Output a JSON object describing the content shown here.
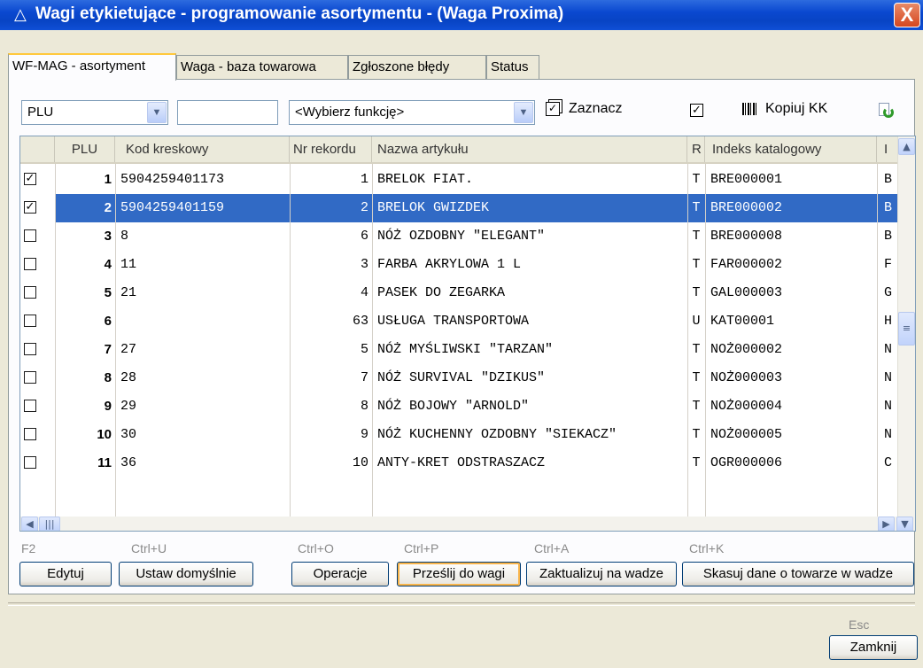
{
  "window": {
    "title": "Wagi etykietujące - programowanie asortymentu - (Waga Proxima)",
    "close": "X"
  },
  "tabs": [
    {
      "label": "WF-MAG - asortyment"
    },
    {
      "label": "Waga - baza towarowa"
    },
    {
      "label": "Zgłoszone błędy"
    },
    {
      "label": "Status"
    }
  ],
  "toolbar": {
    "field_select": "PLU",
    "search_value": "",
    "function_select": "<Wybierz funkcję>",
    "mark_label": "Zaznacz",
    "copy_label": "Kopiuj KK"
  },
  "grid": {
    "headers": [
      "PLU",
      "Kod kreskowy",
      "Nr rekordu",
      "Nazwa artykułu",
      "R",
      "Indeks katalogowy",
      "I"
    ],
    "rows": [
      {
        "checked": true,
        "plu": "1",
        "barcode": "5904259401173",
        "rec": "1",
        "name": "BRELOK FIAT.",
        "r": "T",
        "index": "BRE000001",
        "extra": "B"
      },
      {
        "checked": true,
        "plu": "2",
        "barcode": "5904259401159",
        "rec": "2",
        "name": "BRELOK GWIZDEK",
        "r": "T",
        "index": "BRE000002",
        "extra": "B",
        "selected": true
      },
      {
        "checked": false,
        "plu": "3",
        "barcode": "8",
        "rec": "6",
        "name": "NÓŻ OZDOBNY \"ELEGANT\"",
        "r": "T",
        "index": "BRE000008",
        "extra": "B"
      },
      {
        "checked": false,
        "plu": "4",
        "barcode": "11",
        "rec": "3",
        "name": "FARBA AKRYLOWA 1 L",
        "r": "T",
        "index": "FAR000002",
        "extra": "F"
      },
      {
        "checked": false,
        "plu": "5",
        "barcode": "21",
        "rec": "4",
        "name": "PASEK DO ZEGARKA",
        "r": "T",
        "index": "GAL000003",
        "extra": "G"
      },
      {
        "checked": false,
        "plu": "6",
        "barcode": "",
        "rec": "63",
        "name": "USŁUGA TRANSPORTOWA",
        "r": "U",
        "index": "KAT00001",
        "extra": "H"
      },
      {
        "checked": false,
        "plu": "7",
        "barcode": "27",
        "rec": "5",
        "name": "NÓŻ MYŚLIWSKI \"TARZAN\"",
        "r": "T",
        "index": "NOŻ000002",
        "extra": "N"
      },
      {
        "checked": false,
        "plu": "8",
        "barcode": "28",
        "rec": "7",
        "name": "NÓŻ SURVIVAL \"DZIKUS\"",
        "r": "T",
        "index": "NOŻ000003",
        "extra": "N"
      },
      {
        "checked": false,
        "plu": "9",
        "barcode": "29",
        "rec": "8",
        "name": "NÓŻ BOJOWY \"ARNOLD\"",
        "r": "T",
        "index": "NOŻ000004",
        "extra": "N"
      },
      {
        "checked": false,
        "plu": "10",
        "barcode": "30",
        "rec": "9",
        "name": "NÓŻ KUCHENNY OZDOBNY \"SIEKACZ\"",
        "r": "T",
        "index": "NOŻ000005",
        "extra": "N"
      },
      {
        "checked": false,
        "plu": "11",
        "barcode": "36",
        "rec": "10",
        "name": "ANTY-KRET ODSTRASZACZ",
        "r": "T",
        "index": "OGR000006",
        "extra": "C"
      }
    ]
  },
  "actions": [
    {
      "key": "F2",
      "label": "Edytuj"
    },
    {
      "key": "Ctrl+U",
      "label": "Ustaw domyślnie"
    },
    {
      "key": "Ctrl+O",
      "label": "Operacje"
    },
    {
      "key": "Ctrl+P",
      "label": "Prześlij do wagi"
    },
    {
      "key": "Ctrl+A",
      "label": "Zaktualizuj na wadze"
    },
    {
      "key": "Ctrl+K",
      "label": "Skasuj dane o towarze w wadze"
    }
  ],
  "footer": {
    "key": "Esc",
    "close_label": "Zamknij"
  },
  "colors": {
    "title_bar": "#0a48d0",
    "selection": "#316ac5",
    "tab_highlight": "#ffc83c",
    "refresh_icon": "#2f9a2a"
  }
}
